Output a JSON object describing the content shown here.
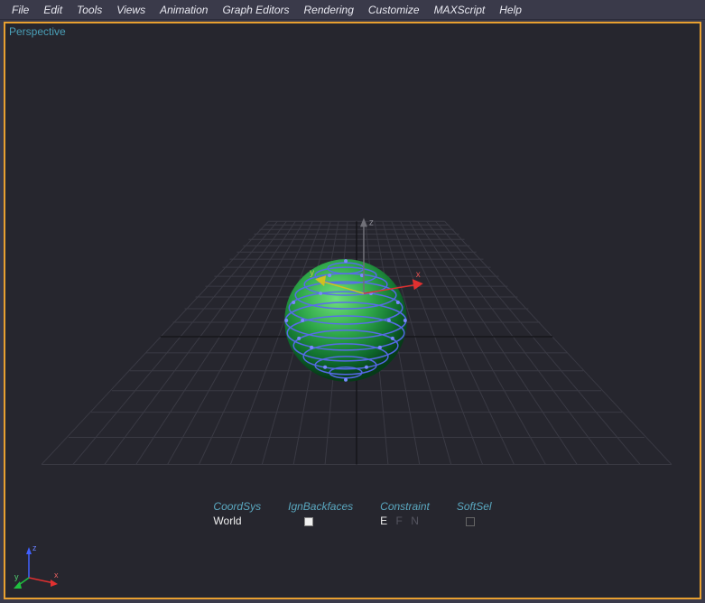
{
  "menu": {
    "items": [
      "File",
      "Edit",
      "Tools",
      "Views",
      "Animation",
      "Graph Editors",
      "Rendering",
      "Customize",
      "MAXScript",
      "Help"
    ]
  },
  "viewport": {
    "label": "Perspective",
    "axes": {
      "x": "x",
      "y": "y",
      "z": "z"
    },
    "gizmo": {
      "x": "x",
      "y": "y",
      "z": "z"
    }
  },
  "status": {
    "coordSys": {
      "label": "CoordSys",
      "value": "World"
    },
    "ignBackfaces": {
      "label": "IgnBackfaces"
    },
    "constraint": {
      "label": "Constraint",
      "value_active": "E",
      "value_dim1": "F",
      "value_dim2": "N"
    },
    "softSel": {
      "label": "SoftSel"
    }
  }
}
